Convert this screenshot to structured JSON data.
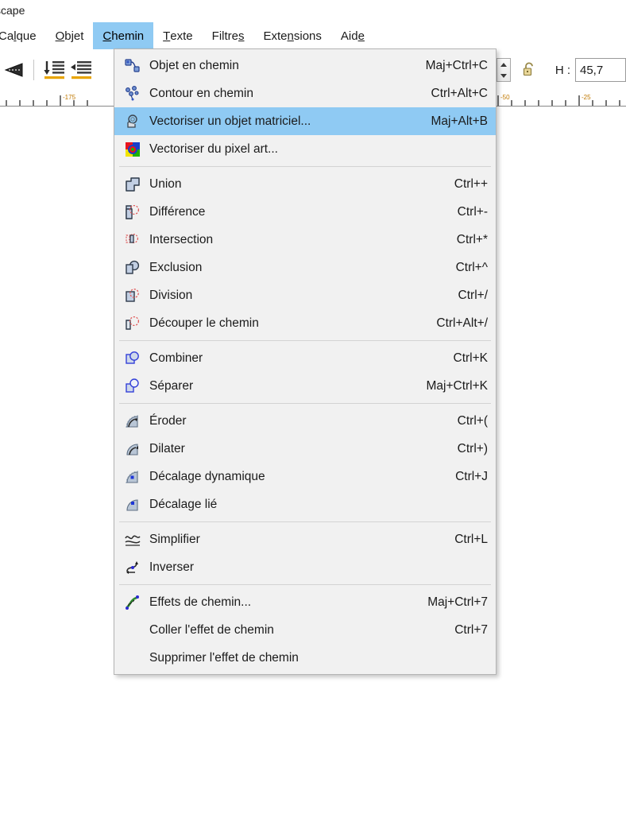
{
  "window": {
    "title": "scape"
  },
  "menubar": {
    "items": [
      {
        "label": "Calque",
        "mnemonic": "l",
        "active": false
      },
      {
        "label": "Objet",
        "mnemonic": "O",
        "active": false
      },
      {
        "label": "Chemin",
        "mnemonic": "C",
        "active": true
      },
      {
        "label": "Texte",
        "mnemonic": "T",
        "active": false
      },
      {
        "label": "Filtres",
        "mnemonic": "s",
        "active": false
      },
      {
        "label": "Extensions",
        "mnemonic": "n",
        "active": false
      },
      {
        "label": "Aide",
        "mnemonic": "e",
        "active": false
      }
    ]
  },
  "toolbar": {
    "icons": [
      {
        "name": "flip-horizontal-icon"
      },
      {
        "name": "align-bottom-icon"
      },
      {
        "name": "align-left-indent-icon"
      }
    ],
    "spinner_name": "value-stepper",
    "lock_icon": "unlock-icon",
    "lock_state": "unlocked",
    "height_label": "H :",
    "height_value": "45,7"
  },
  "rulers": {
    "horizontal_ticks": [
      "-175",
      "-50",
      "-25"
    ]
  },
  "path_menu": {
    "title": "Chemin",
    "groups": [
      {
        "items": [
          {
            "icon": "object-to-path-icon",
            "label": "Objet en chemin",
            "accel": "Maj+Ctrl+C",
            "selected": false
          },
          {
            "icon": "stroke-to-path-icon",
            "label": "Contour en chemin",
            "accel": "Ctrl+Alt+C",
            "selected": false
          },
          {
            "icon": "trace-bitmap-icon",
            "label": "Vectoriser un objet matriciel...",
            "accel": "Maj+Alt+B",
            "selected": true
          },
          {
            "icon": "trace-pixelart-icon",
            "label": "Vectoriser du pixel art...",
            "accel": "",
            "selected": false
          }
        ]
      },
      {
        "items": [
          {
            "icon": "union-icon",
            "label": "Union",
            "accel": "Ctrl++",
            "selected": false
          },
          {
            "icon": "difference-icon",
            "label": "Différence",
            "accel": "Ctrl+-",
            "selected": false
          },
          {
            "icon": "intersection-icon",
            "label": "Intersection",
            "accel": "Ctrl+*",
            "selected": false
          },
          {
            "icon": "exclusion-icon",
            "label": "Exclusion",
            "accel": "Ctrl+^",
            "selected": false
          },
          {
            "icon": "division-icon",
            "label": "Division",
            "accel": "Ctrl+/",
            "selected": false
          },
          {
            "icon": "cut-path-icon",
            "label": "Découper le chemin",
            "accel": "Ctrl+Alt+/",
            "selected": false
          }
        ]
      },
      {
        "items": [
          {
            "icon": "combine-icon",
            "label": "Combiner",
            "accel": "Ctrl+K",
            "selected": false
          },
          {
            "icon": "break-apart-icon",
            "label": "Séparer",
            "accel": "Maj+Ctrl+K",
            "selected": false
          }
        ]
      },
      {
        "items": [
          {
            "icon": "inset-icon",
            "label": "Éroder",
            "accel": "Ctrl+(",
            "selected": false
          },
          {
            "icon": "outset-icon",
            "label": "Dilater",
            "accel": "Ctrl+)",
            "selected": false
          },
          {
            "icon": "dynamic-offset-icon",
            "label": "Décalage dynamique",
            "accel": "Ctrl+J",
            "selected": false
          },
          {
            "icon": "linked-offset-icon",
            "label": "Décalage lié",
            "accel": "",
            "selected": false
          }
        ]
      },
      {
        "items": [
          {
            "icon": "simplify-icon",
            "label": "Simplifier",
            "accel": "Ctrl+L",
            "selected": false
          },
          {
            "icon": "reverse-icon",
            "label": "Inverser",
            "accel": "",
            "selected": false
          }
        ]
      },
      {
        "items": [
          {
            "icon": "path-effects-icon",
            "label": "Effets de chemin...",
            "accel": "Maj+Ctrl+7",
            "selected": false
          },
          {
            "icon": "",
            "label": "Coller l'effet de chemin",
            "accel": "Ctrl+7",
            "selected": false
          },
          {
            "icon": "",
            "label": "Supprimer l'effet de chemin",
            "accel": "",
            "selected": false
          }
        ]
      }
    ]
  },
  "colors": {
    "highlight": "#8fcaf3",
    "menu_bg": "#f1f1f1",
    "menu_border": "#b4b4b4",
    "text": "#1b1b1b",
    "separator": "#d3d3d3"
  }
}
